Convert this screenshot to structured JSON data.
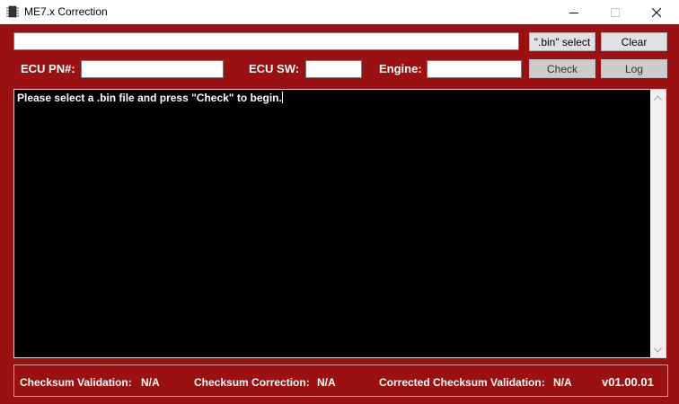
{
  "window": {
    "title": "ME7.x Correction",
    "icon": "chip-icon"
  },
  "toolbar": {
    "path_value": "",
    "select_label": "\".bin\" select",
    "clear_label": "Clear",
    "check_label": "Check",
    "log_label": "Log"
  },
  "fields": {
    "pn_label": "ECU PN#:",
    "pn_value": "",
    "sw_label": "ECU SW:",
    "sw_value": "",
    "engine_label": "Engine:",
    "engine_value": ""
  },
  "console": {
    "text": "Please select a .bin file and press \"Check\" to begin."
  },
  "status": {
    "validation_label": "Checksum Validation:",
    "validation_value": "N/A",
    "correction_label": "Checksum Correction:",
    "correction_value": "N/A",
    "corrected_validation_label": "Corrected Checksum Validation:",
    "corrected_validation_value": "N/A",
    "version": "v01.00.01"
  },
  "colors": {
    "background": "#9b1010",
    "console_bg": "#000000",
    "text": "#ffffff"
  }
}
